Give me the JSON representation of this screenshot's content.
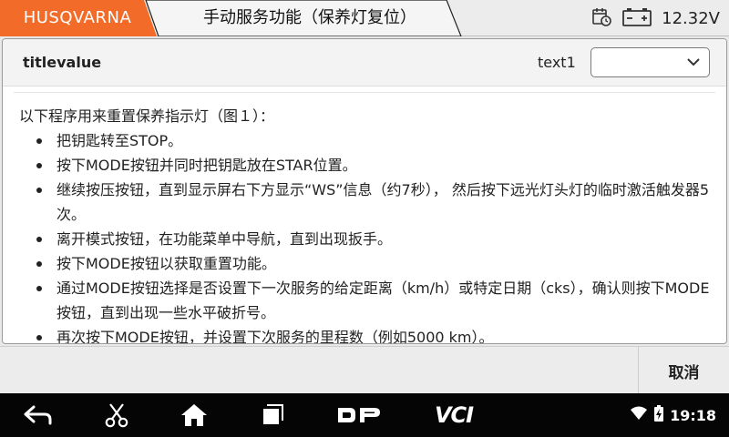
{
  "header": {
    "brand": "HUSQVARNA",
    "title": "手动服务功能（保养灯复位）",
    "voltage": "12.32V",
    "colors": {
      "brand": "#f26b28"
    },
    "icons": {
      "calendar": "calendar-clock-icon",
      "battery": "car-battery-icon"
    }
  },
  "card": {
    "title": "titlevalue",
    "select_label": "text1",
    "select_value": "",
    "intro": "以下程序用来重置保养指示灯（图１）：",
    "steps": [
      "把钥匙转至STOP。",
      "按下MODE按钮并同时把钥匙放在STAR位置。",
      "继续按压按钮，直到显示屏右下方显示“WS”信息（约7秒）， 然后按下远光灯头灯的临时激活触发器5次。",
      "离开模式按钮，在功能菜单中导航，直到出现扳手。",
      "按下MODE按钮以获取重置功能。",
      "通过MODE按钮选择是否设置下一次服务的给定距离（km/h）或特定日期（cks），确认则按下MODE按钮，直到出现一些水平破折号。",
      "再次按下MODE按钮，并设置下次服务的里程数（例如5000 km）。"
    ]
  },
  "actions": {
    "cancel": "取消"
  },
  "navbar": {
    "vci": "VCI",
    "time": "19:18",
    "icons": [
      "back-icon",
      "scissors-icon",
      "home-icon",
      "recent-apps-icon",
      "dp-icon",
      "vci-icon",
      "wifi-icon",
      "battery-icon"
    ]
  }
}
